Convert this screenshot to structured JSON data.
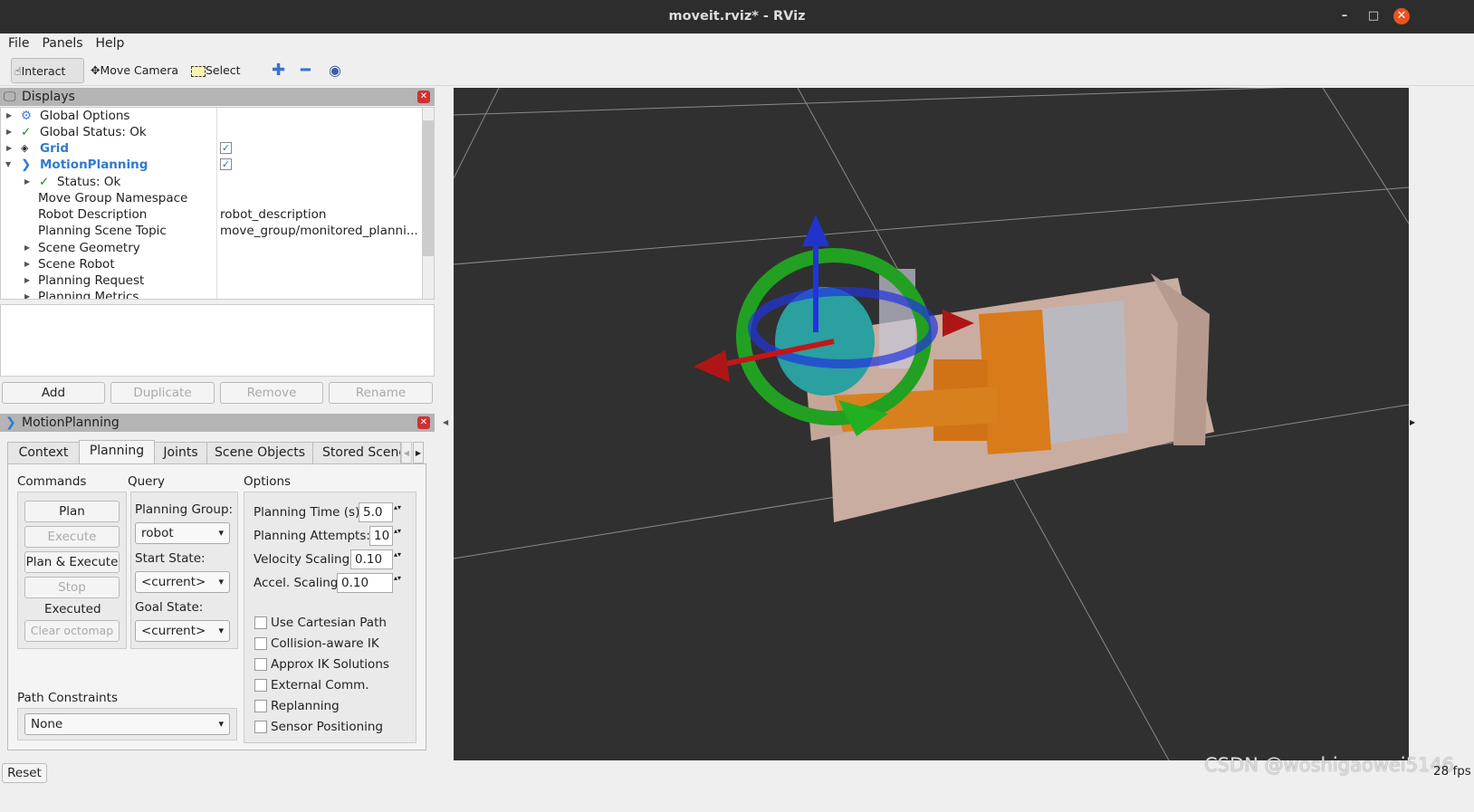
{
  "window": {
    "title": "moveit.rviz* - RViz",
    "min": "–",
    "max": "□",
    "close": "✕"
  },
  "menu": [
    "File",
    "Panels",
    "Help"
  ],
  "toolbar": {
    "interact": "Interact",
    "move_camera": "Move Camera",
    "select": "Select",
    "add_icon": "plus-icon",
    "remove_icon": "minus-icon",
    "view_icon": "eye-icon"
  },
  "displays": {
    "title": "Displays",
    "rows": [
      {
        "label": "Global Options",
        "value": ""
      },
      {
        "label": "Global Status: Ok",
        "value": ""
      },
      {
        "label": "Grid",
        "checked": true
      },
      {
        "label": "MotionPlanning",
        "checked": true
      },
      {
        "label": "Status: Ok",
        "value": ""
      },
      {
        "label": "Move Group Namespace",
        "value": ""
      },
      {
        "label": "Robot Description",
        "value": "robot_description"
      },
      {
        "label": "Planning Scene Topic",
        "value": "move_group/monitored_planni..."
      },
      {
        "label": "Scene Geometry",
        "value": ""
      },
      {
        "label": "Scene Robot",
        "value": ""
      },
      {
        "label": "Planning Request",
        "value": ""
      },
      {
        "label": "Planning Metrics",
        "value": ""
      }
    ],
    "buttons": [
      "Add",
      "Duplicate",
      "Remove",
      "Rename"
    ]
  },
  "motion": {
    "title": "MotionPlanning",
    "tabs": [
      "Context",
      "Planning",
      "Joints",
      "Scene Objects",
      "Stored Scene"
    ],
    "active_tab": "Planning",
    "commands": {
      "title": "Commands",
      "plan": "Plan",
      "execute": "Execute",
      "plan_execute": "Plan & Execute",
      "stop": "Stop",
      "status": "Executed",
      "clear": "Clear octomap"
    },
    "query": {
      "title": "Query",
      "planning_group_label": "Planning Group:",
      "planning_group": "robot",
      "start_label": "Start State:",
      "start": "<current>",
      "goal_label": "Goal State:",
      "goal": "<current>"
    },
    "options": {
      "title": "Options",
      "planning_time_label": "Planning Time (s):",
      "planning_time": "5.0",
      "attempts_label": "Planning Attempts:",
      "attempts": "10",
      "velocity_label": "Velocity Scaling:",
      "velocity": "0.10",
      "accel_label": "Accel. Scaling:",
      "accel": "0.10",
      "checks": [
        {
          "label": "Use Cartesian Path",
          "checked": false
        },
        {
          "label": "Collision-aware IK",
          "checked": false
        },
        {
          "label": "Approx IK Solutions",
          "checked": false
        },
        {
          "label": "External Comm.",
          "checked": false
        },
        {
          "label": "Replanning",
          "checked": false
        },
        {
          "label": "Sensor Positioning",
          "checked": false
        }
      ]
    },
    "path_constraints": {
      "label": "Path Constraints",
      "value": "None"
    }
  },
  "status": {
    "reset": "Reset",
    "fps": "28 fps",
    "watermark": "CSDN @woshigaowei5146"
  }
}
